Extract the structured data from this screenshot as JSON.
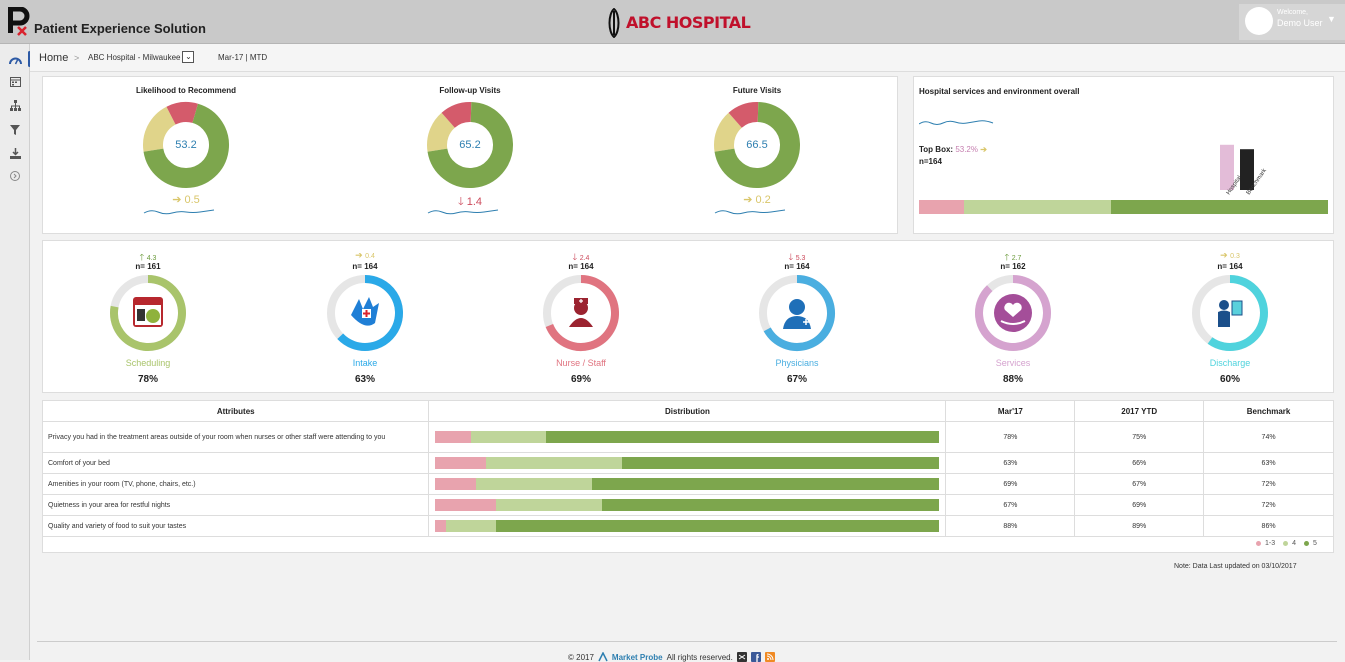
{
  "header": {
    "app_title": "Patient Experience Solution",
    "hospital_name": "ABC HOSPITAL",
    "welcome": "Welcome,",
    "user": "Demo User"
  },
  "nav": {
    "icons": [
      "dashboard-icon",
      "calendar-icon",
      "sitemap-icon",
      "filter-icon",
      "download-icon",
      "expand-icon"
    ]
  },
  "breadcrumb": {
    "home": "Home",
    "sep": ">",
    "location": "ABC Hospital - Milwaukee",
    "period": "Mar-17 | MTD"
  },
  "colors": {
    "green": "#7da64d",
    "light_green": "#bfd59a",
    "red": "#d45b6b",
    "pink": "#e8a3ae",
    "yellow": "#e0d48a",
    "up": "#6b9a3c",
    "flat": "#d9c66a",
    "down": "#cc4a5c"
  },
  "gauges": [
    {
      "title": "Likelihood to Recommend",
      "value": "53.2",
      "trend": "0.5",
      "trend_dir": "flat",
      "fractions": [
        0.68,
        0.12,
        0.2
      ]
    },
    {
      "title": "Follow-up Visits",
      "value": "65.2",
      "trend": "1.4",
      "trend_dir": "down",
      "fractions": [
        0.72,
        0.12,
        0.16
      ]
    },
    {
      "title": "Future Visits",
      "value": "66.5",
      "trend": "0.2",
      "trend_dir": "flat",
      "fractions": [
        0.72,
        0.12,
        0.16
      ]
    }
  ],
  "overall": {
    "title": "Hospital services and environment overall",
    "topbox_label": "Top Box:",
    "topbox_value": "53.2%",
    "n": "n=164",
    "bar_labels": [
      "Hospital",
      "Benchmark"
    ],
    "bar_values": [
      53.2,
      48
    ],
    "distribution": [
      0.11,
      0.36,
      0.53
    ]
  },
  "services": [
    {
      "trend": "4.3",
      "trend_dir": "up",
      "n": "n= 161",
      "label": "Scheduling",
      "pct": "78%",
      "value": 0.78,
      "color": "#a9c46b",
      "icon": "calendar-icon"
    },
    {
      "trend": "0.4",
      "trend_dir": "flat",
      "n": "n= 164",
      "label": "Intake",
      "pct": "63%",
      "value": 0.63,
      "color": "#2aa9e8",
      "icon": "hand-icon"
    },
    {
      "trend": "2.4",
      "trend_dir": "down",
      "n": "n= 164",
      "label": "Nurse / Staff",
      "pct": "69%",
      "value": 0.69,
      "color": "#e07480",
      "icon": "nurse-icon"
    },
    {
      "trend": "5.3",
      "trend_dir": "down",
      "n": "n= 164",
      "label": "Physicians",
      "pct": "67%",
      "value": 0.67,
      "color": "#4aaee0",
      "icon": "doctor-icon"
    },
    {
      "trend": "2.7",
      "trend_dir": "up",
      "n": "n= 162",
      "label": "Services",
      "pct": "88%",
      "value": 0.88,
      "color": "#d5a3cf",
      "icon": "heart-hand-icon"
    },
    {
      "trend": "0.3",
      "trend_dir": "flat",
      "n": "n= 164",
      "label": "Discharge",
      "pct": "60%",
      "value": 0.6,
      "color": "#4fd3dd",
      "icon": "discharge-icon"
    }
  ],
  "table": {
    "headers": [
      "Attributes",
      "Distribution",
      "Mar'17",
      "2017 YTD",
      "Benchmark"
    ],
    "rows": [
      {
        "attribute": "Privacy you had in the treatment areas outside of your room when nurses or other staff were attending to you",
        "dist": [
          0.07,
          0.15,
          0.78
        ],
        "mar": "78%",
        "ytd": "75%",
        "bench": "74%"
      },
      {
        "attribute": "Comfort of your bed",
        "dist": [
          0.1,
          0.27,
          0.63
        ],
        "mar": "63%",
        "ytd": "66%",
        "bench": "63%"
      },
      {
        "attribute": "Amenities in your room (TV, phone, chairs, etc.)",
        "dist": [
          0.08,
          0.23,
          0.69
        ],
        "mar": "69%",
        "ytd": "67%",
        "bench": "72%"
      },
      {
        "attribute": "Quietness in your area for restful nights",
        "dist": [
          0.12,
          0.21,
          0.67
        ],
        "mar": "67%",
        "ytd": "69%",
        "bench": "72%"
      },
      {
        "attribute": "Quality and variety of food to suit your tastes",
        "dist": [
          0.02,
          0.1,
          0.88
        ],
        "mar": "88%",
        "ytd": "89%",
        "bench": "86%"
      }
    ],
    "legend": [
      "1-3",
      "4",
      "5"
    ]
  },
  "note": "Note: Data Last updated on 03/10/2017",
  "footer": {
    "copyright": "© 2017",
    "brand": "Market Probe",
    "rights": "All rights reserved."
  }
}
